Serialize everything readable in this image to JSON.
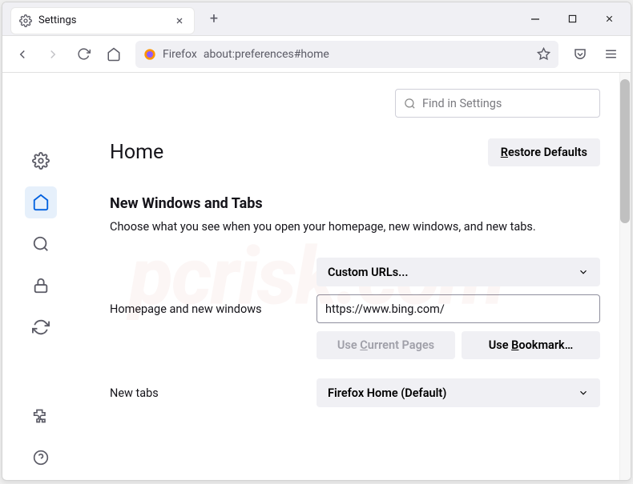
{
  "tab": {
    "title": "Settings"
  },
  "urlbar": {
    "firefox_label": "Firefox",
    "url": "about:preferences#home"
  },
  "search": {
    "placeholder": "Find in Settings"
  },
  "page": {
    "title": "Home",
    "restore_defaults": "Restore Defaults"
  },
  "section": {
    "title": "New Windows and Tabs",
    "desc": "Choose what you see when you open your homepage, new windows, and new tabs."
  },
  "homepage": {
    "label": "Homepage and new windows",
    "dropdown_value": "Custom URLs...",
    "input_value": "https://www.bing.com/",
    "use_current": "Use Current Pages",
    "use_bookmark": "Use Bookmark…"
  },
  "newtabs": {
    "label": "New tabs",
    "dropdown_value": "Firefox Home (Default)"
  }
}
